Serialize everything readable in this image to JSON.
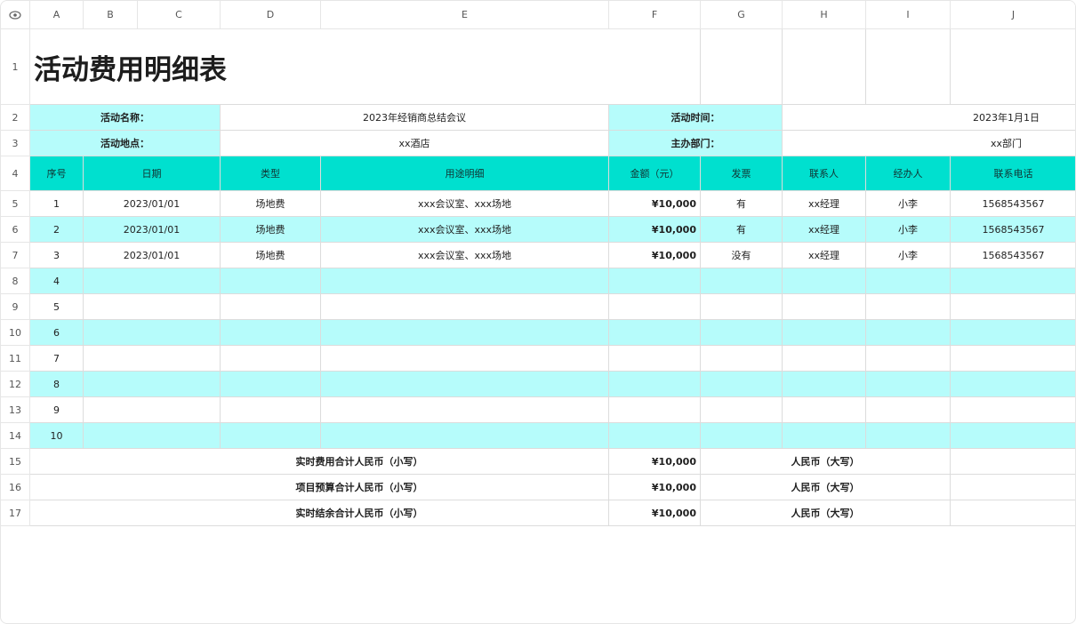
{
  "sheet": {
    "columns": [
      "A",
      "B",
      "C",
      "D",
      "E",
      "F",
      "G",
      "H",
      "I",
      "J"
    ],
    "rows": [
      "1",
      "2",
      "3",
      "4",
      "5",
      "6",
      "7",
      "8",
      "9",
      "10",
      "11",
      "12",
      "13",
      "14",
      "15",
      "16",
      "17"
    ]
  },
  "title": "活动费用明细表",
  "info": {
    "activity_name_label": "活动名称：",
    "activity_name_value": "2023年经销商总结会议",
    "activity_time_label": "活动时间：",
    "activity_time_value": "2023年1月1日",
    "activity_location_label": "活动地点：",
    "activity_location_value": "xx酒店",
    "organizer_label": "主办部门：",
    "organizer_value": "xx部门"
  },
  "table": {
    "headers": [
      "序号",
      "日期",
      "类型",
      "用途明细",
      "金额（元）",
      "发票",
      "联系人",
      "经办人",
      "联系电话"
    ],
    "rows": [
      {
        "seq": "1",
        "date": "2023/01/01",
        "type": "场地费",
        "detail": "xxx会议室、xxx场地",
        "amount": "¥10,000",
        "invoice": "有",
        "contact": "xx经理",
        "handler": "小李",
        "phone": "1568543567"
      },
      {
        "seq": "2",
        "date": "2023/01/01",
        "type": "场地费",
        "detail": "xxx会议室、xxx场地",
        "amount": "¥10,000",
        "invoice": "有",
        "contact": "xx经理",
        "handler": "小李",
        "phone": "1568543567"
      },
      {
        "seq": "3",
        "date": "2023/01/01",
        "type": "场地费",
        "detail": "xxx会议室、xxx场地",
        "amount": "¥10,000",
        "invoice": "没有",
        "contact": "xx经理",
        "handler": "小李",
        "phone": "1568543567"
      },
      {
        "seq": "4"
      },
      {
        "seq": "5"
      },
      {
        "seq": "6"
      },
      {
        "seq": "7"
      },
      {
        "seq": "8"
      },
      {
        "seq": "9"
      },
      {
        "seq": "10"
      }
    ]
  },
  "summary": [
    {
      "label": "实时费用合计人民币（小写）",
      "amount": "¥10,000",
      "cap_label": "人民币（大写）"
    },
    {
      "label": "项目预算合计人民币（小写）",
      "amount": "¥10,000",
      "cap_label": "人民币（大写）"
    },
    {
      "label": "实时结余合计人民币（小写）",
      "amount": "¥10,000",
      "cap_label": "人民币（大写）"
    }
  ],
  "colors": {
    "header_teal": "#00e0cf",
    "row_light": "#b6fcfb"
  },
  "icons": {
    "corner": "eye-icon"
  }
}
